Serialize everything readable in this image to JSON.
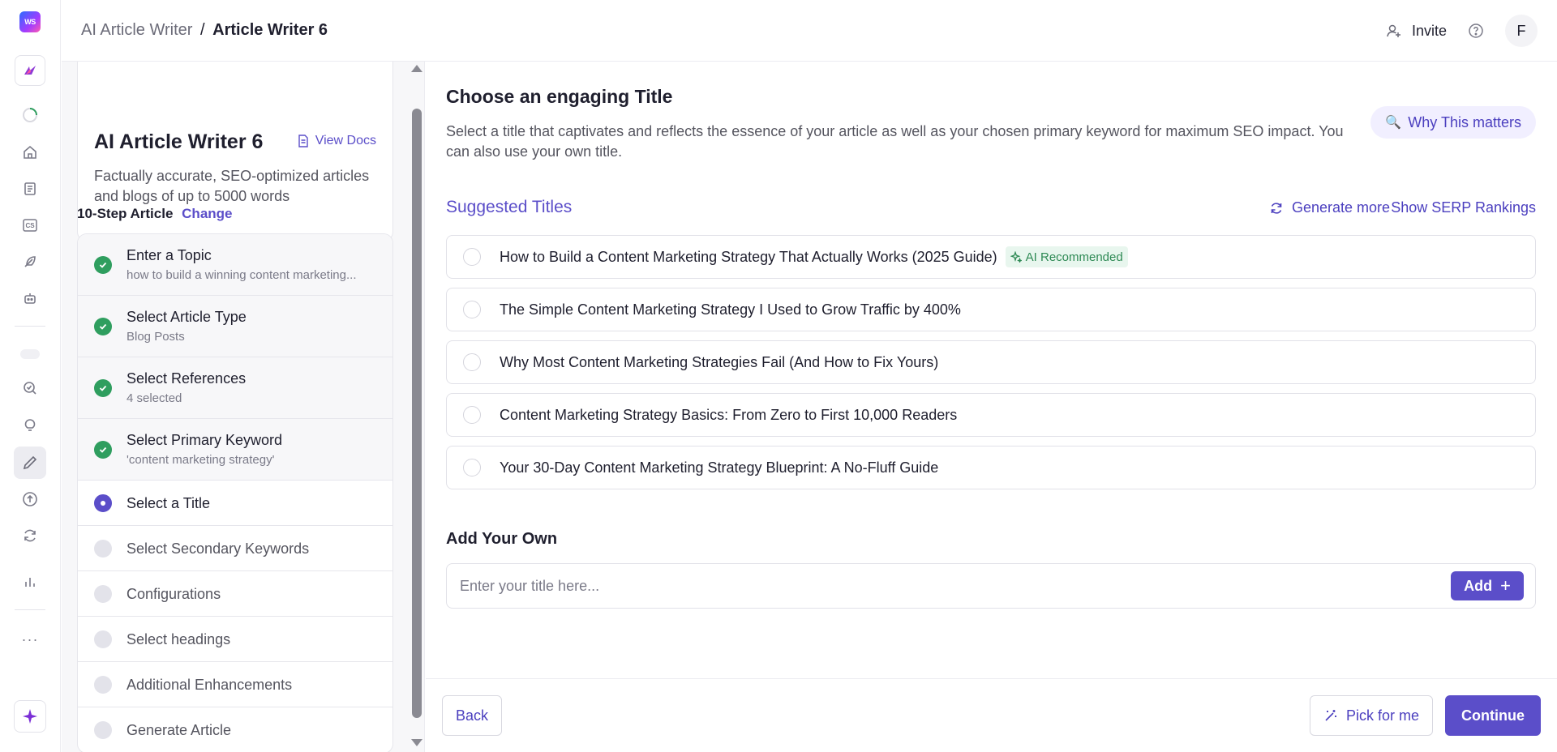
{
  "rail": {
    "logo_text": "WS",
    "icons": [
      "app-icon",
      "loading-icon",
      "home-icon",
      "document-list-icon",
      "cs-icon",
      "feather-icon",
      "robot-icon",
      "search-check-icon",
      "lightbulb-icon",
      "pencil-icon",
      "upload-circle-icon",
      "refresh-icon",
      "bar-chart-icon",
      "more-icon",
      "sparkle-icon"
    ],
    "cs_label": "CS",
    "more_label": "···"
  },
  "breadcrumb": {
    "parent": "AI Article Writer",
    "separator": "/",
    "current": "Article Writer 6"
  },
  "topbar": {
    "invite_label": "Invite",
    "avatar_initial": "F"
  },
  "writer": {
    "title": "AI Article Writer 6",
    "docs_label": "View Docs",
    "description": "Factually accurate, SEO-optimized articles and blogs of up to 5000 words"
  },
  "steps_header": {
    "label": "10-Step Article",
    "change_label": "Change"
  },
  "steps": [
    {
      "label": "Enter a Topic",
      "sub": "how to build a winning content marketing...",
      "status": "done"
    },
    {
      "label": "Select Article Type",
      "sub": "Blog Posts",
      "status": "done"
    },
    {
      "label": "Select References",
      "sub": "4 selected",
      "status": "done"
    },
    {
      "label": "Select Primary Keyword",
      "sub": "'content marketing strategy'",
      "status": "done"
    },
    {
      "label": "Select a Title",
      "status": "current"
    },
    {
      "label": "Select Secondary Keywords",
      "status": "todo"
    },
    {
      "label": "Configurations",
      "status": "todo"
    },
    {
      "label": "Select headings",
      "status": "todo"
    },
    {
      "label": "Additional Enhancements",
      "status": "todo"
    },
    {
      "label": "Generate Article",
      "status": "todo"
    }
  ],
  "main": {
    "title": "Choose an engaging Title",
    "description": "Select a title that captivates and reflects the essence of your article as well as your chosen primary keyword for maximum SEO impact. You can also use your own title.",
    "why_label": "Why This matters",
    "why_glyph": "🔍",
    "suggested_label": "Suggested Titles",
    "generate_more_label": "Generate more",
    "serp_label": "Show SERP Rankings",
    "titles": [
      "How to Build a Content Marketing Strategy That Actually Works (2025 Guide)",
      "The Simple Content Marketing Strategy I Used to Grow Traffic by 400%",
      "Why Most Content Marketing Strategies Fail (And How to Fix Yours)",
      "Content Marketing Strategy Basics: From Zero to First 10,000 Readers",
      "Your 30-Day Content Marketing Strategy Blueprint: A No-Fluff Guide"
    ],
    "ai_badge": "AI Recommended",
    "own_label": "Add Your Own",
    "own_placeholder": "Enter your title here...",
    "own_value": "",
    "add_label": "Add",
    "add_plus": "+"
  },
  "footer": {
    "back_label": "Back",
    "pick_label": "Pick for me",
    "continue_label": "Continue"
  },
  "colors": {
    "accent": "#5b4ec9",
    "success": "#2f9e5f",
    "ai_badge_bg": "#e8f6ee",
    "ai_badge_text": "#2f8a55"
  }
}
